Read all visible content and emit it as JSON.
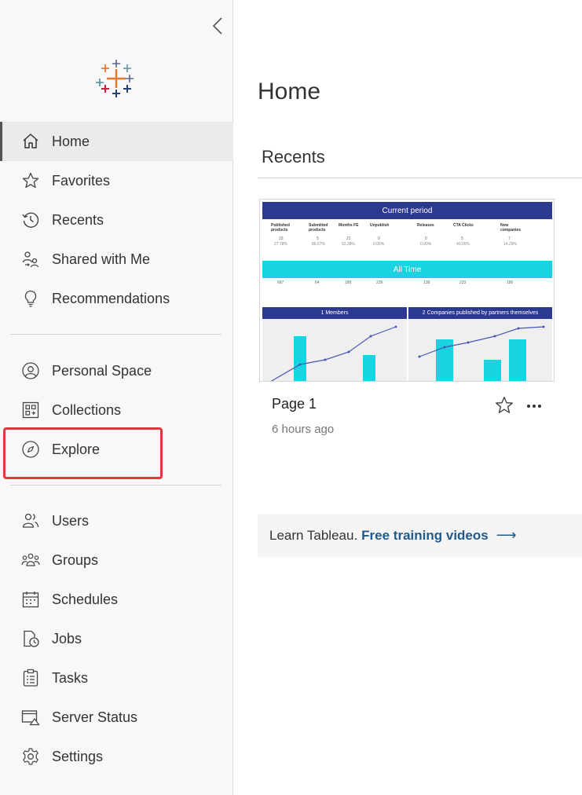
{
  "sidebar": {
    "items_top": [
      {
        "name": "home",
        "label": "Home",
        "icon": "home-icon"
      },
      {
        "name": "favorites",
        "label": "Favorites",
        "icon": "star-icon"
      },
      {
        "name": "recents",
        "label": "Recents",
        "icon": "history-icon"
      },
      {
        "name": "shared-with-me",
        "label": "Shared with Me",
        "icon": "shared-users-icon"
      },
      {
        "name": "recommendations",
        "label": "Recommendations",
        "icon": "lightbulb-icon"
      }
    ],
    "items_mid": [
      {
        "name": "personal-space",
        "label": "Personal Space",
        "icon": "user-circle-icon"
      },
      {
        "name": "collections",
        "label": "Collections",
        "icon": "collections-icon"
      },
      {
        "name": "explore",
        "label": "Explore",
        "icon": "compass-icon"
      }
    ],
    "items_admin": [
      {
        "name": "users",
        "label": "Users",
        "icon": "users-icon"
      },
      {
        "name": "groups",
        "label": "Groups",
        "icon": "groups-icon"
      },
      {
        "name": "schedules",
        "label": "Schedules",
        "icon": "calendar-icon"
      },
      {
        "name": "jobs",
        "label": "Jobs",
        "icon": "jobs-clock-icon"
      },
      {
        "name": "tasks",
        "label": "Tasks",
        "icon": "clipboard-icon"
      },
      {
        "name": "server-status",
        "label": "Server Status",
        "icon": "server-status-icon"
      },
      {
        "name": "settings",
        "label": "Settings",
        "icon": "gear-icon"
      }
    ],
    "active": "Home",
    "highlighted": "Explore"
  },
  "main": {
    "title": "Home",
    "recents_heading": "Recents",
    "card": {
      "title": "Page 1",
      "subtitle": "6 hours ago",
      "thumbnail": {
        "banner_current": "Current period",
        "banner_all": "All Time",
        "panel_left": "1 Members",
        "panel_right": "2 Companies published by partners themselves",
        "current_columns": [
          "Published products",
          "Submitted products",
          "Months FE",
          "Unpublish",
          "Releases",
          "CTA Clicks",
          "New companies"
        ],
        "current_values": [
          "33",
          "5",
          "21",
          "0",
          "0",
          "5",
          "7"
        ],
        "current_percents": [
          "27.78%",
          "86.67%",
          "52.38%",
          "0.00%",
          "0.00%",
          "40.00%",
          "14.29%"
        ],
        "alltime_values": [
          "687",
          "64",
          "189",
          "239",
          "138",
          "233",
          "186"
        ]
      }
    },
    "learn": {
      "prefix": "Learn Tableau.",
      "link": "Free training videos",
      "arrow": "⟶"
    }
  },
  "colors": {
    "accent_link": "#1f5a8a",
    "highlight": "#e0383e",
    "thumb_navy": "#2b3990",
    "thumb_cyan": "#19d3e0"
  }
}
